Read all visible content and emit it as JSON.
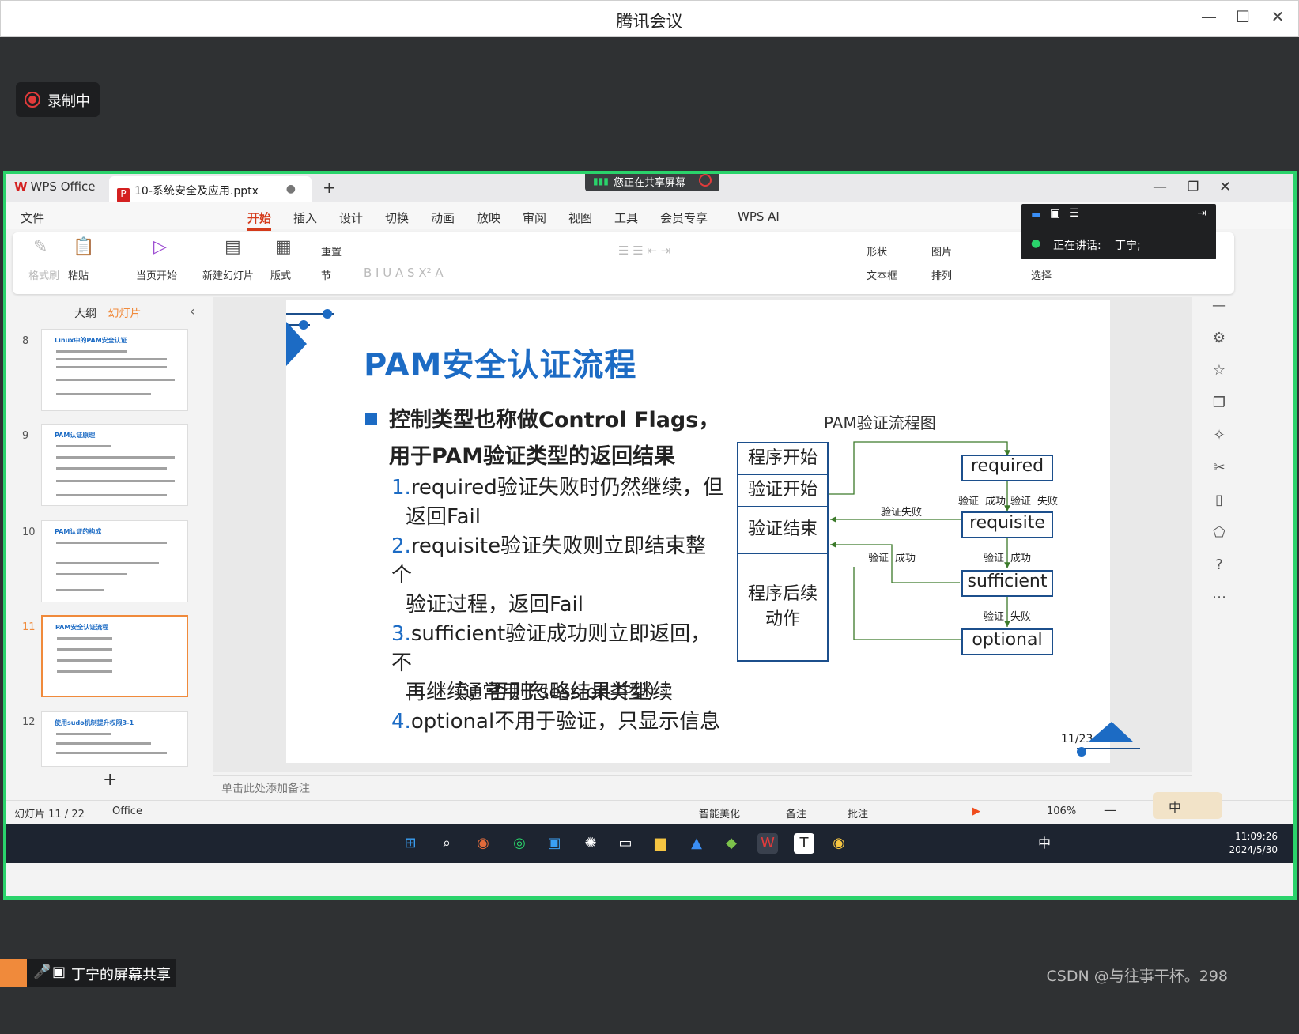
{
  "window": {
    "title": "腾讯会议"
  },
  "recording": {
    "label": "录制中"
  },
  "share_badge": {
    "label": "您正在共享屏幕"
  },
  "wps": {
    "app_tab": "WPS Office",
    "doc_tab": "10-系统安全及应用.pptx",
    "menu": [
      "文件",
      "开始",
      "插入",
      "设计",
      "切换",
      "动画",
      "放映",
      "审阅",
      "视图",
      "工具",
      "会员专享",
      "WPS AI"
    ],
    "active_menu": "开始",
    "ribbon": {
      "format_painter": "格式刷",
      "paste": "粘贴",
      "from_current": "当页开始",
      "new_slide": "新建幻灯片",
      "layout": "版式",
      "reset": "重置",
      "section": "节",
      "shape": "形状",
      "picture": "图片",
      "textbox": "文本框",
      "arrange": "排列",
      "select": "选择"
    },
    "speaking": {
      "label": "正在讲话:",
      "name": "丁宁;"
    }
  },
  "panel": {
    "tab_outline": "大纲",
    "tab_slides": "幻灯片",
    "thumbnails": [
      {
        "num": "8",
        "title": "Linux中的PAM安全认证"
      },
      {
        "num": "9",
        "title": "PAM认证原理"
      },
      {
        "num": "10",
        "title": "PAM认证的构成"
      },
      {
        "num": "11",
        "title": "PAM安全认证流程"
      },
      {
        "num": "12",
        "title": "使用sudo机制提升权限3-1"
      }
    ],
    "add": "+"
  },
  "slide": {
    "title": "PAM安全认证流程",
    "bullet_line1": "控制类型也称做Control Flags，",
    "bullet_line2": "用于PAM验证类型的返回结果",
    "items": [
      {
        "n": "1.",
        "a": "required验证失败时仍然继续，但",
        "b": "返回Fail"
      },
      {
        "n": "2.",
        "a": "requisite验证失败则立即结束整个",
        "b": "验证过程，返回Fail"
      },
      {
        "n": "3.",
        "a": "sufficient验证成功则立即返回，不",
        "b": "再继续，否则忽略结果并继续"
      },
      {
        "n": "4.",
        "a": "optional不用于验证，只显示信息",
        "b": ""
      }
    ],
    "sub": "（通常用于session类型）",
    "diagram": {
      "title": "PAM验证流程图",
      "left_boxes": [
        "程序开始",
        "验证开始",
        "验证结束",
        "程序后续动作"
      ],
      "right_boxes": [
        "required",
        "requisite",
        "sufficient",
        "optional"
      ],
      "labels": {
        "verify": "验证",
        "success": "成功",
        "fail": "失败",
        "verify_fail": "验证失败"
      }
    },
    "page": "11/23"
  },
  "notes_placeholder": "单击此处添加备注",
  "status": {
    "slide_counter": "幻灯片 11 / 22",
    "theme": "Office",
    "beautify": "智能美化",
    "notes": "备注",
    "comment": "批注",
    "zoom": "106%"
  },
  "taskbar": {
    "time": "11:09:26",
    "date": "2024/5/30",
    "ime": "中"
  },
  "ime_badge": "中",
  "bottom": {
    "label": "丁宁的屏幕共享"
  },
  "credit": "CSDN @与往事干杯。298",
  "colors": {
    "accent": "#1c6bc4",
    "share_border": "#2ad36b",
    "record": "#e23b3b"
  }
}
